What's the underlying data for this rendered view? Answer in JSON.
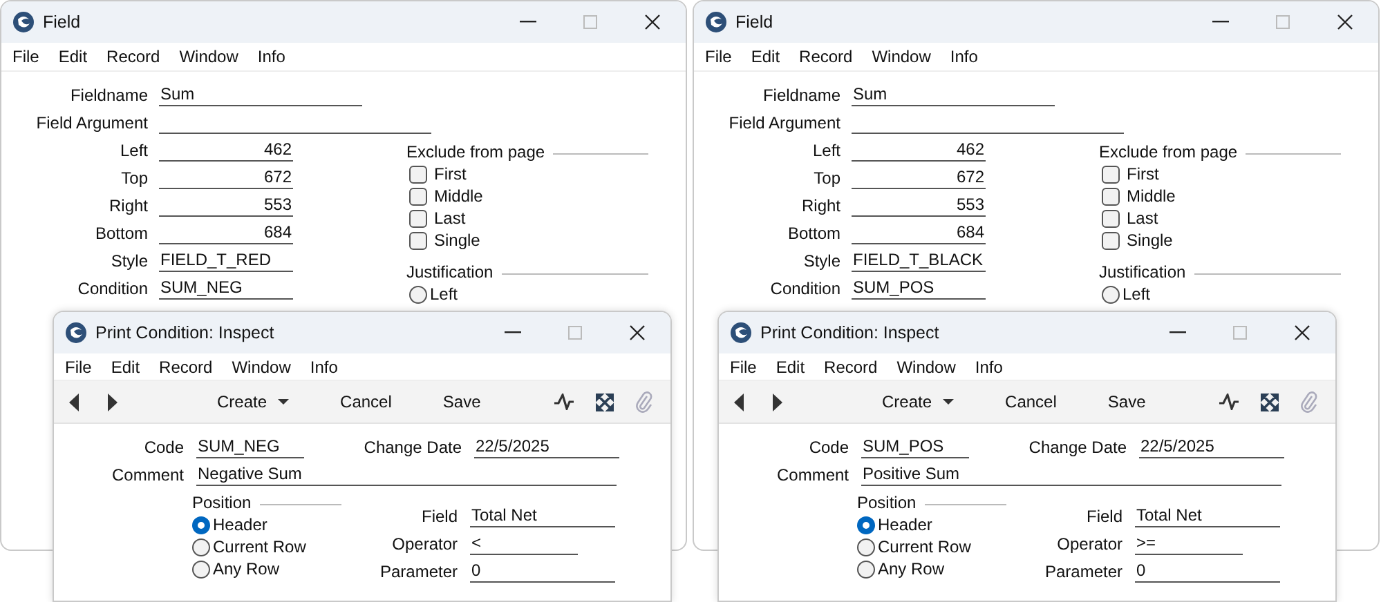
{
  "pairs": [
    {
      "field_window": {
        "title": "Field",
        "menu": [
          "File",
          "Edit",
          "Record",
          "Window",
          "Info"
        ],
        "fields": [
          {
            "label": "Fieldname",
            "value": "Sum",
            "kind": "medium"
          },
          {
            "label": "Field Argument",
            "kind": "long"
          },
          {
            "label": "Left",
            "value": "462",
            "kind": "number"
          },
          {
            "label": "Top",
            "value": "672",
            "kind": "number"
          },
          {
            "label": "Right",
            "value": "553",
            "kind": "number"
          },
          {
            "label": "Bottom",
            "value": "684",
            "kind": "number"
          },
          {
            "label": "Style",
            "value": "FIELD_T_RED",
            "kind": "short"
          },
          {
            "label": "Condition",
            "value": "SUM_NEG",
            "kind": "short"
          }
        ],
        "exclude_from_page": {
          "label": "Exclude from page",
          "options": [
            {
              "label": "First",
              "checked": false
            },
            {
              "label": "Middle",
              "checked": false
            },
            {
              "label": "Last",
              "checked": false
            },
            {
              "label": "Single",
              "checked": false
            }
          ]
        },
        "justification": {
          "label": "Justification",
          "options": [
            {
              "label": "Left",
              "selected": false
            }
          ]
        }
      },
      "condition_window": {
        "title": "Print Condition: Inspect",
        "menu": [
          "File",
          "Edit",
          "Record",
          "Window",
          "Info"
        ],
        "toolbar": [
          {
            "label": "Create",
            "kind": "menu"
          },
          {
            "label": "Cancel",
            "kind": "plain"
          },
          {
            "label": "Save",
            "kind": "plain"
          }
        ],
        "code": {
          "label": "Code",
          "value": "SUM_NEG"
        },
        "change_date": {
          "label": "Change Date",
          "value": "22/5/2025"
        },
        "comment": {
          "label": "Comment",
          "value": "Negative Sum"
        },
        "position": {
          "label": "Position",
          "options": [
            {
              "label": "Header",
              "selected": true
            },
            {
              "label": "Current Row",
              "selected": false
            },
            {
              "label": "Any Row",
              "selected": false
            }
          ]
        },
        "criteria": [
          {
            "label": "Field",
            "value": "Total Net",
            "kind": "long"
          },
          {
            "label": "Operator",
            "value": "<",
            "kind": "short"
          },
          {
            "label": "Parameter",
            "value": "0",
            "kind": "long"
          }
        ]
      }
    },
    {
      "field_window": {
        "title": "Field",
        "menu": [
          "File",
          "Edit",
          "Record",
          "Window",
          "Info"
        ],
        "fields": [
          {
            "label": "Fieldname",
            "value": "Sum",
            "kind": "medium"
          },
          {
            "label": "Field Argument",
            "kind": "long"
          },
          {
            "label": "Left",
            "value": "462",
            "kind": "number"
          },
          {
            "label": "Top",
            "value": "672",
            "kind": "number"
          },
          {
            "label": "Right",
            "value": "553",
            "kind": "number"
          },
          {
            "label": "Bottom",
            "value": "684",
            "kind": "number"
          },
          {
            "label": "Style",
            "value": "FIELD_T_BLACK",
            "kind": "short"
          },
          {
            "label": "Condition",
            "value": "SUM_POS",
            "kind": "short"
          }
        ],
        "exclude_from_page": {
          "label": "Exclude from page",
          "options": [
            {
              "label": "First",
              "checked": false
            },
            {
              "label": "Middle",
              "checked": false
            },
            {
              "label": "Last",
              "checked": false
            },
            {
              "label": "Single",
              "checked": false
            }
          ]
        },
        "justification": {
          "label": "Justification",
          "options": [
            {
              "label": "Left",
              "selected": false
            }
          ]
        }
      },
      "condition_window": {
        "title": "Print Condition: Inspect",
        "menu": [
          "File",
          "Edit",
          "Record",
          "Window",
          "Info"
        ],
        "toolbar": [
          {
            "label": "Create",
            "kind": "menu"
          },
          {
            "label": "Cancel",
            "kind": "plain"
          },
          {
            "label": "Save",
            "kind": "plain"
          }
        ],
        "code": {
          "label": "Code",
          "value": "SUM_POS"
        },
        "change_date": {
          "label": "Change Date",
          "value": "22/5/2025"
        },
        "comment": {
          "label": "Comment",
          "value": "Positive Sum"
        },
        "position": {
          "label": "Position",
          "options": [
            {
              "label": "Header",
              "selected": true
            },
            {
              "label": "Current Row",
              "selected": false
            },
            {
              "label": "Any Row",
              "selected": false
            }
          ]
        },
        "criteria": [
          {
            "label": "Field",
            "value": "Total Net",
            "kind": "long"
          },
          {
            "label": "Operator",
            "value": ">=",
            "kind": "short"
          },
          {
            "label": "Parameter",
            "value": "0",
            "kind": "long"
          }
        ]
      }
    }
  ]
}
